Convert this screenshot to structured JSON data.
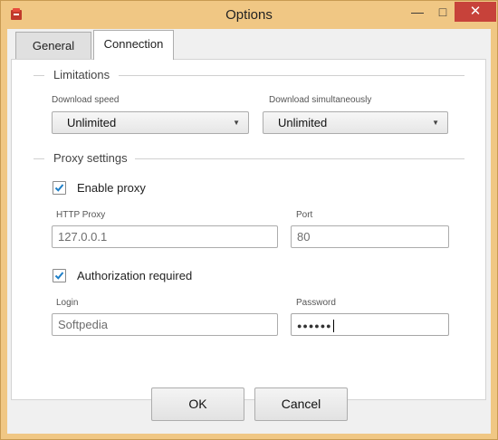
{
  "window": {
    "title": "Options"
  },
  "tabs": [
    {
      "label": "General"
    },
    {
      "label": "Connection"
    }
  ],
  "limitations": {
    "title": "Limitations",
    "download_speed": {
      "label": "Download speed",
      "value": "Unlimited"
    },
    "download_simultaneously": {
      "label": "Download simultaneously",
      "value": "Unlimited"
    }
  },
  "proxy": {
    "title": "Proxy settings",
    "enable_proxy": {
      "label": "Enable proxy",
      "checked": true
    },
    "http_proxy": {
      "label": "HTTP Proxy",
      "value": "127.0.0.1"
    },
    "port": {
      "label": "Port",
      "value": "80"
    },
    "authorization": {
      "label": "Authorization required",
      "checked": true
    },
    "login": {
      "label": "Login",
      "value": "Softpedia"
    },
    "password": {
      "label": "Password",
      "value": "●●●●●●"
    }
  },
  "buttons": {
    "ok": "OK",
    "cancel": "Cancel"
  },
  "colors": {
    "accent": "#1e7fc8",
    "close": "#c7423a",
    "frame": "#f0c784"
  },
  "icons": {
    "app": "app-icon",
    "check": "checkmark-icon"
  }
}
